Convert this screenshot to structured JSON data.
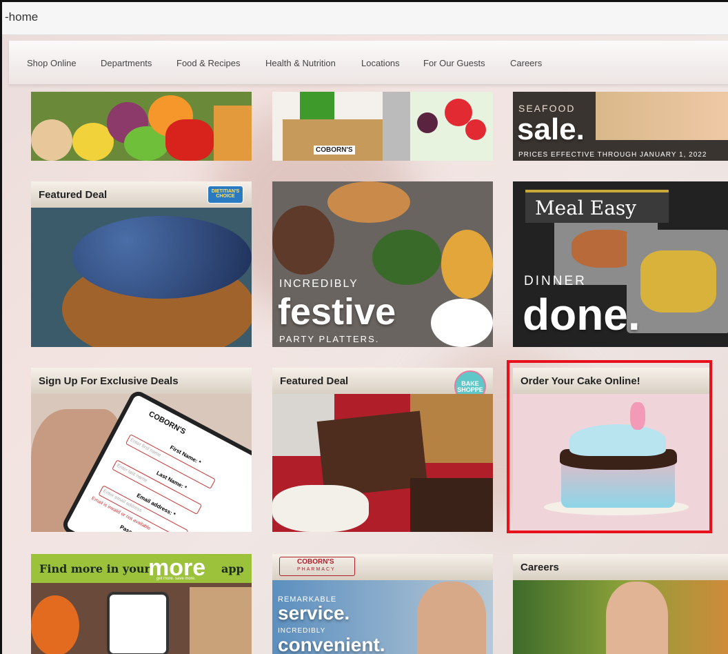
{
  "tab": {
    "title": "-home"
  },
  "nav": {
    "items": [
      "Shop Online",
      "Departments",
      "Food & Recipes",
      "Health & Nutrition",
      "Locations",
      "For Our Guests",
      "Careers"
    ]
  },
  "tiles": {
    "seafood": {
      "big": "sale.",
      "top": "SEAFOOD",
      "sub": "PRICES EFFECTIVE THROUGH JANUARY 1, 2022"
    },
    "grocery_bag": {
      "label": "COBORN'S"
    },
    "featured_blueberries": {
      "title": "Featured Deal",
      "badge": "DIETITIAN'S CHOICE"
    },
    "platters": {
      "top": "INCREDIBLY",
      "big": "festive",
      "sub": "PARTY PLATTERS."
    },
    "meal_easy": {
      "logo": "Meal Easy",
      "top": "DINNER",
      "big": "done."
    },
    "signup": {
      "title": "Sign Up For Exclusive Deals",
      "brand": "COBORN'S",
      "f1": "First Name: *",
      "p1": "Enter first name",
      "f2": "Last Name: *",
      "p2": "Enter last name",
      "f3": "Email address: *",
      "p3": "Enter email address",
      "err": "Email is invalid or not available",
      "f4": "Password"
    },
    "featured_fudge": {
      "title": "Featured Deal",
      "badge": "BAKE SHOPPE"
    },
    "cake": {
      "title": "Order Your Cake Online!"
    },
    "more_app": {
      "pre": "Find more in your",
      "brand": "more",
      "post": "app",
      "tag": "get more. save more."
    },
    "pharmacy": {
      "brand": "COBORN'S",
      "brand2": "PHARMACY",
      "l1": "REMARKABLE",
      "l2": "service.",
      "l3": "INCREDIBLY",
      "l4": "convenient."
    },
    "careers": {
      "title": "Careers"
    }
  },
  "colors": {
    "highlight": "#e8101a",
    "more_green": "#9cc13b",
    "nav_text": "#444444"
  }
}
